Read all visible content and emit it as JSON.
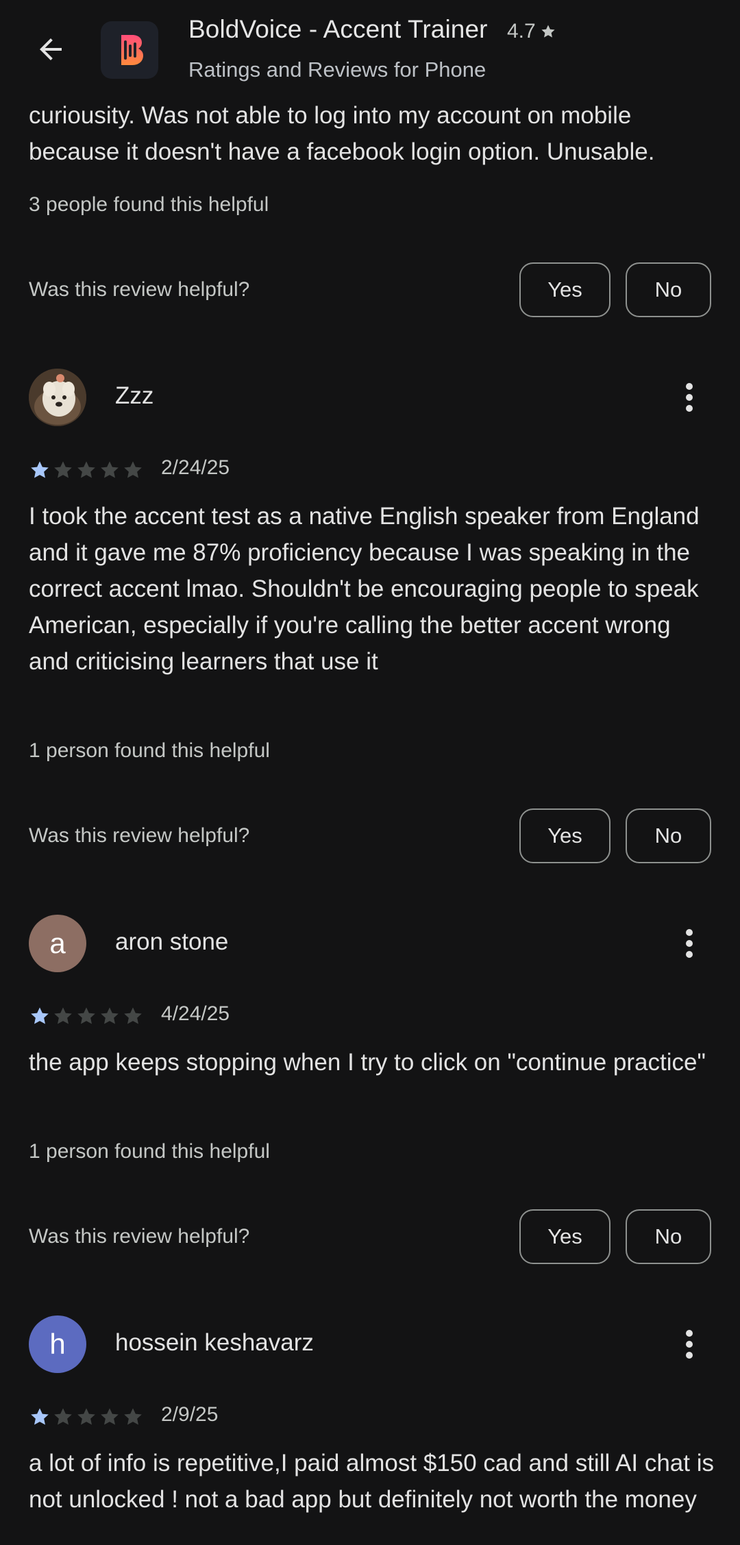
{
  "header": {
    "back_icon": "arrow-back-icon",
    "app_name": "BoldVoice - Accent Trainer",
    "rating": "4.7",
    "subtitle": "Ratings and Reviews for Phone"
  },
  "colors": {
    "background": "#131314",
    "star_filled": "#a8c7fa",
    "star_empty": "#444746",
    "avatar_aron": "#8d6e63",
    "avatar_hossein": "#5c6bc0"
  },
  "reviews": [
    {
      "body": "curiousity. Was not able to log into my account on mobile because it doesn't have a facebook login option. Unusable.",
      "found_helpful": "3 people found this helpful",
      "helpful_question": "Was this review helpful?",
      "yes_label": "Yes",
      "no_label": "No"
    },
    {
      "name": "Zzz",
      "avatar_icon": "dog-photo-avatar",
      "rating": 1,
      "date": "2/24/25",
      "body": "I took the accent test as a native English speaker from England and it gave me 87% proficiency because I was speaking in the correct accent lmao. Shouldn't be encouraging people to speak American, especially if you're calling the better accent wrong and criticising learners that use it",
      "found_helpful": "1 person found this helpful",
      "helpful_question": "Was this review helpful?",
      "yes_label": "Yes",
      "no_label": "No"
    },
    {
      "name": "aron stone",
      "avatar_letter": "a",
      "rating": 1,
      "date": "4/24/25",
      "body": "the app keeps stopping when I try to click on \"continue practice\"",
      "found_helpful": "1 person found this helpful",
      "helpful_question": "Was this review helpful?",
      "yes_label": "Yes",
      "no_label": "No"
    },
    {
      "name": "hossein keshavarz",
      "avatar_letter": "h",
      "rating": 1,
      "date": "2/9/25",
      "body": "a lot of info is repetitive,I paid almost $150 cad and still AI chat is not unlocked ! not a bad app but definitely not worth the money"
    }
  ]
}
